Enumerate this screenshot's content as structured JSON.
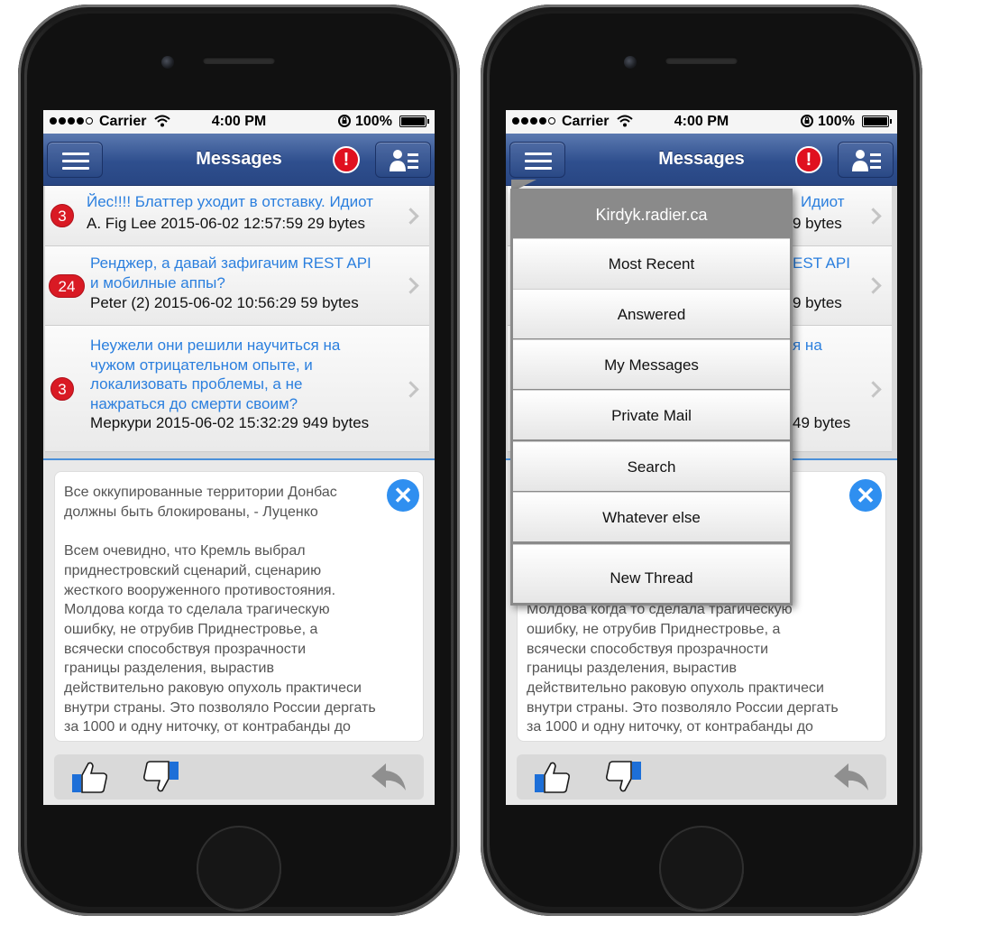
{
  "phones": {
    "left": {
      "status_bar": {
        "carrier": "Carrier",
        "time": "4:00 PM",
        "battery": "100%"
      },
      "nav": {
        "title": "Messages"
      },
      "messages": [
        {
          "badge": "3",
          "subject": "Йес!!!! Блаттер уходит в отставку. Идиот",
          "meta": "A. Fig Lee 2015-06-02 12:57:59 29 bytes"
        },
        {
          "badge": "24",
          "subject": "Ренджер, а давай зафигачим REST API\nи мобилные аппы?",
          "meta": "Peter (2) 2015-06-02 10:56:29 59 bytes"
        },
        {
          "badge": "3",
          "subject": "Неужели они решили научиться на\nчужом отрицательном опыте, и\nлокализовать проблемы, а не\nнажраться до смерти своим?",
          "meta": "Меркури 2015-06-02 15:32:29 949 bytes"
        }
      ],
      "detail": {
        "text": "Все оккупированные территории Донбас\nдолжны быть блокированы, - Луценко\n\nВсем очевидно, что Кремль выбрал\nприднестровский сценарий, сценарию\nжесткого вооруженного противостояния.\nМолдова когда то сделала трагическую\nошибку, не отрубив Приднестровье, а\nвсячески способствуя прозрачности\nграницы разделения, вырастив\nдействительно раковую опухоль практичеси\nвнутри страны. Это позволяло России дергать\nза 1000 и одну ниточку, от контрабанды до"
      }
    },
    "right": {
      "status_bar": {
        "carrier": "Carrier",
        "time": "4:00 PM",
        "battery": "100%"
      },
      "nav": {
        "title": "Messages"
      },
      "messages_visible": [
        {
          "subject": "Идиот",
          "meta": "9 bytes"
        },
        {
          "subject": "EST API",
          "meta": "9 bytes"
        },
        {
          "subject": "я на",
          "meta": "49 bytes"
        }
      ],
      "detail": {
        "text": "онбас\nенко\n\n\n\n\nМолдова когда то сделала трагическую\nошибку, не отрубив Приднестровье, а\nвсячески способствуя прозрачности\nграницы разделения, вырастив\nдействительно раковую опухоль практичеси\nвнутри страны. Это позволяло России дергать\nза 1000 и одну ниточку, от контрабанды до"
      },
      "menu": {
        "header": "Kirdyk.radier.ca",
        "items": [
          "Most Recent",
          "Answered",
          "My Messages",
          "Private Mail",
          "Search",
          "Whatever else",
          "New Thread"
        ]
      }
    }
  },
  "icons": {
    "menu": "hamburger-icon",
    "alert": "alert-icon",
    "contacts": "contact-list-icon",
    "close": "close-icon",
    "like": "thumbs-up-icon",
    "dislike": "thumbs-down-icon",
    "reply": "reply-icon"
  },
  "colors": {
    "nav_blue": "#2f4f8e",
    "link_blue": "#2b7fde",
    "badge_red": "#d91a24",
    "alert_red": "#e0101f",
    "close_blue": "#2f8ff0",
    "menu_gray": "#8a8a8a"
  }
}
